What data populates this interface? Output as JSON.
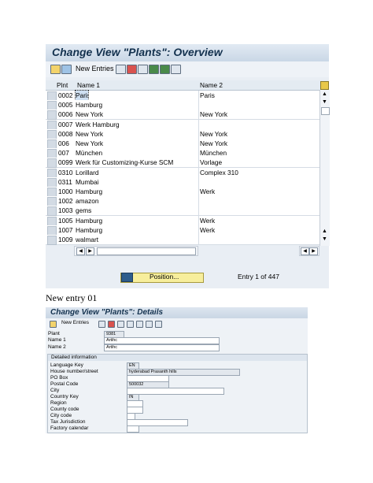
{
  "screen1": {
    "title": "Change View \"Plants\": Overview",
    "toolbar": {
      "new_entries_label": "New Entries"
    },
    "columns": [
      "Plnt",
      "Name 1",
      "Name 2"
    ],
    "rows": [
      {
        "plnt": "0002",
        "name1": "Paris",
        "name2": "Paris"
      },
      {
        "plnt": "0005",
        "name1": "Hamburg",
        "name2": ""
      },
      {
        "plnt": "0006",
        "name1": "New York",
        "name2": "New York"
      },
      {
        "plnt": "0007",
        "name1": "Werk Hamburg",
        "name2": ""
      },
      {
        "plnt": "0008",
        "name1": "New York",
        "name2": "New York"
      },
      {
        "plnt": "006",
        "name1": "New York",
        "name2": "New York"
      },
      {
        "plnt": "007",
        "name1": "München",
        "name2": "München"
      },
      {
        "plnt": "0099",
        "name1": "Werk für Customizing-Kurse SCM",
        "name2": "Vorlage"
      },
      {
        "plnt": "0310",
        "name1": "Lorillard",
        "name2": "Complex 310"
      },
      {
        "plnt": "0311",
        "name1": "Mumbai",
        "name2": ""
      },
      {
        "plnt": "1000",
        "name1": "Hamburg",
        "name2": "Werk"
      },
      {
        "plnt": "1002",
        "name1": "amazon",
        "name2": ""
      },
      {
        "plnt": "1003",
        "name1": "gems",
        "name2": ""
      },
      {
        "plnt": "1005",
        "name1": "Hamburg",
        "name2": "Werk"
      },
      {
        "plnt": "1007",
        "name1": "Hamburg",
        "name2": "Werk"
      },
      {
        "plnt": "1009",
        "name1": "walmart",
        "name2": ""
      }
    ],
    "position_button_label": "Position...",
    "entry_info": "Entry 1 of 447"
  },
  "caption": "New entry 01",
  "screen2": {
    "title": "Change View \"Plants\": Details",
    "toolbar": {
      "new_entries_label": "New Entries"
    },
    "fields": {
      "plant": {
        "label": "Plant",
        "value": "9381"
      },
      "name1": {
        "label": "Name 1",
        "value": "Artihc"
      },
      "name2": {
        "label": "Name 2",
        "value": "Artihc"
      }
    },
    "group_title": "Detailed information",
    "detail_fields": [
      {
        "label": "Language Key",
        "value": "EN"
      },
      {
        "label": "House number/street",
        "value": "hyderabad Prasanth hills"
      },
      {
        "label": "PO Box",
        "value": ""
      },
      {
        "label": "Postal Code",
        "value": "500032"
      },
      {
        "label": "City",
        "value": ""
      },
      {
        "label": "Country Key",
        "value": "IN"
      },
      {
        "label": "Region",
        "value": ""
      },
      {
        "label": "County code",
        "value": ""
      },
      {
        "label": "City code",
        "value": ""
      },
      {
        "label": "Tax Jurisdiction",
        "value": ""
      },
      {
        "label": "Factory calendar",
        "value": ""
      }
    ]
  }
}
